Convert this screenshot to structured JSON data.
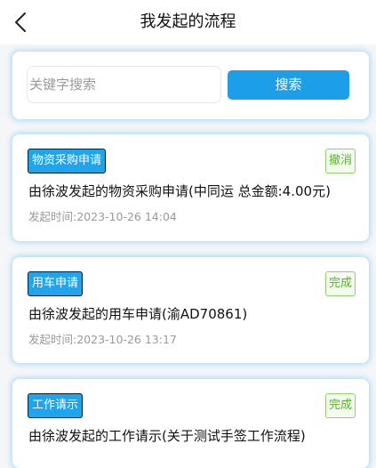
{
  "header": {
    "title": "我发起的流程",
    "back_icon": "chevron-left-icon"
  },
  "search": {
    "placeholder": "关键字搜索",
    "button_label": "搜索"
  },
  "colors": {
    "accent": "#1c9fe8",
    "status_green": "#58b32c",
    "card_glow": "#64befa"
  },
  "processes": [
    {
      "tag": "物资采购申请",
      "status": "撤消",
      "title": "由徐波发起的物资采购申请(中同运 总金额:4.00元)",
      "time": "发起时间:2023-10-26 14:04"
    },
    {
      "tag": "用车申请",
      "status": "完成",
      "title": "由徐波发起的用车申请(渝AD70861)",
      "time": "发起时间:2023-10-26 13:17"
    },
    {
      "tag": "工作请示",
      "status": "完成",
      "title": "由徐波发起的工作请示(关于测试手签工作流程)",
      "time": ""
    }
  ]
}
